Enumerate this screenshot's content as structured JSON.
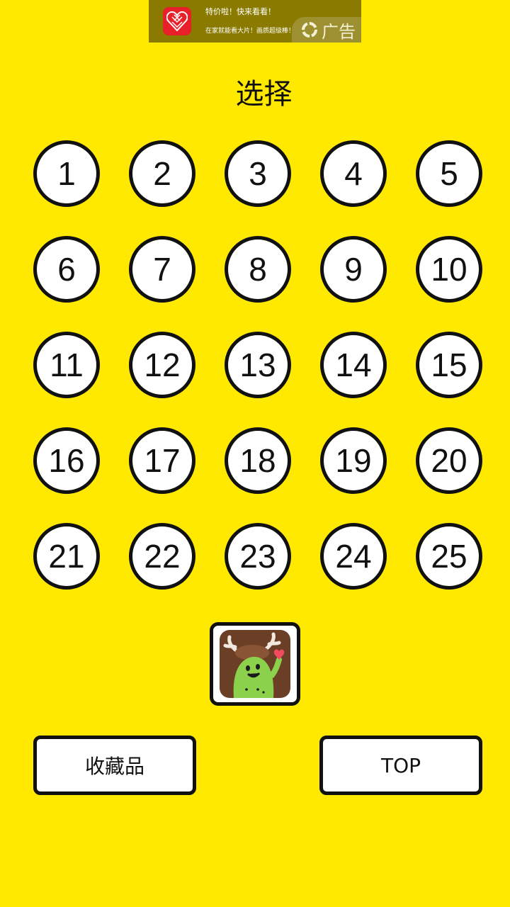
{
  "ad": {
    "headline": "特价啦！快来看看！",
    "description": "在家就能看大片！画质超级棒！",
    "badge_label": "广告",
    "colors": {
      "background": "#8A7B00",
      "logo": "#E8202A"
    }
  },
  "screen": {
    "title": "选择",
    "background_color": "#FFE900"
  },
  "levels": [
    "1",
    "2",
    "3",
    "4",
    "5",
    "6",
    "7",
    "8",
    "9",
    "10",
    "11",
    "12",
    "13",
    "14",
    "15",
    "16",
    "17",
    "18",
    "19",
    "20",
    "21",
    "22",
    "23",
    "24",
    "25"
  ],
  "character": {
    "icon": "character-avatar-icon"
  },
  "buttons": {
    "collection_label": "收藏品",
    "top_label": "TOP"
  }
}
